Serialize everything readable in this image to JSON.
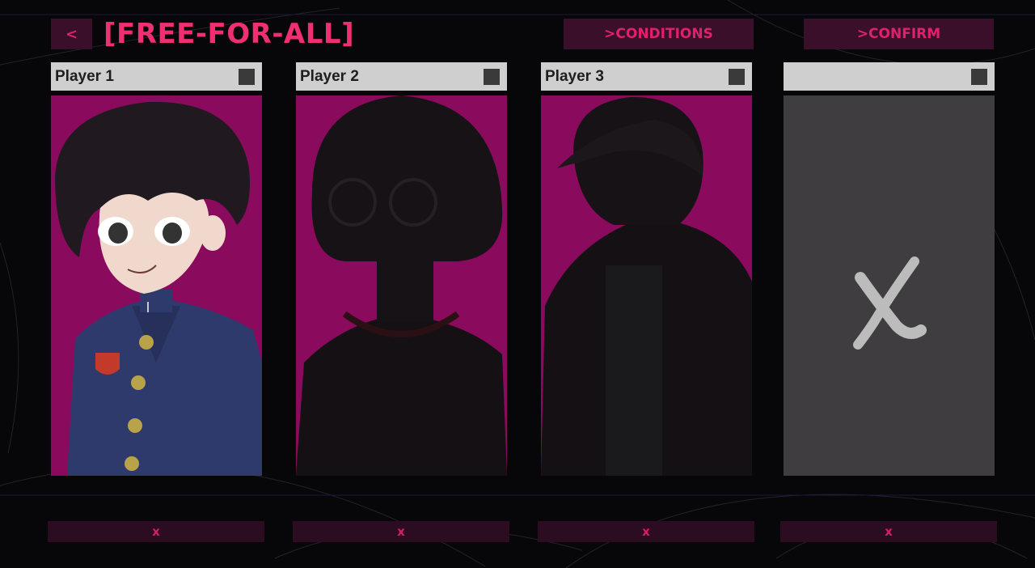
{
  "header": {
    "back_label": "<",
    "title": "[FREE-FOR-ALL]",
    "conditions_label": ">CONDITIONS",
    "confirm_label": ">CONFIRM"
  },
  "slots": [
    {
      "label": "Player 1",
      "state": "selected",
      "remove_label": "x"
    },
    {
      "label": "Player 2",
      "state": "locked",
      "remove_label": "x"
    },
    {
      "label": "Player 3",
      "state": "locked",
      "remove_label": "x"
    },
    {
      "label": "",
      "state": "empty",
      "remove_label": "x"
    }
  ],
  "icons": {
    "empty_slot": "x-mark-icon",
    "checkbox": "checkbox-icon"
  },
  "colors": {
    "accent": "#ef2f72",
    "button_bg": "#3a0f2a",
    "portrait_bg": "#8a0a5e",
    "header_bg": "#cfcfcf",
    "empty_bg": "#3f3d3f"
  }
}
